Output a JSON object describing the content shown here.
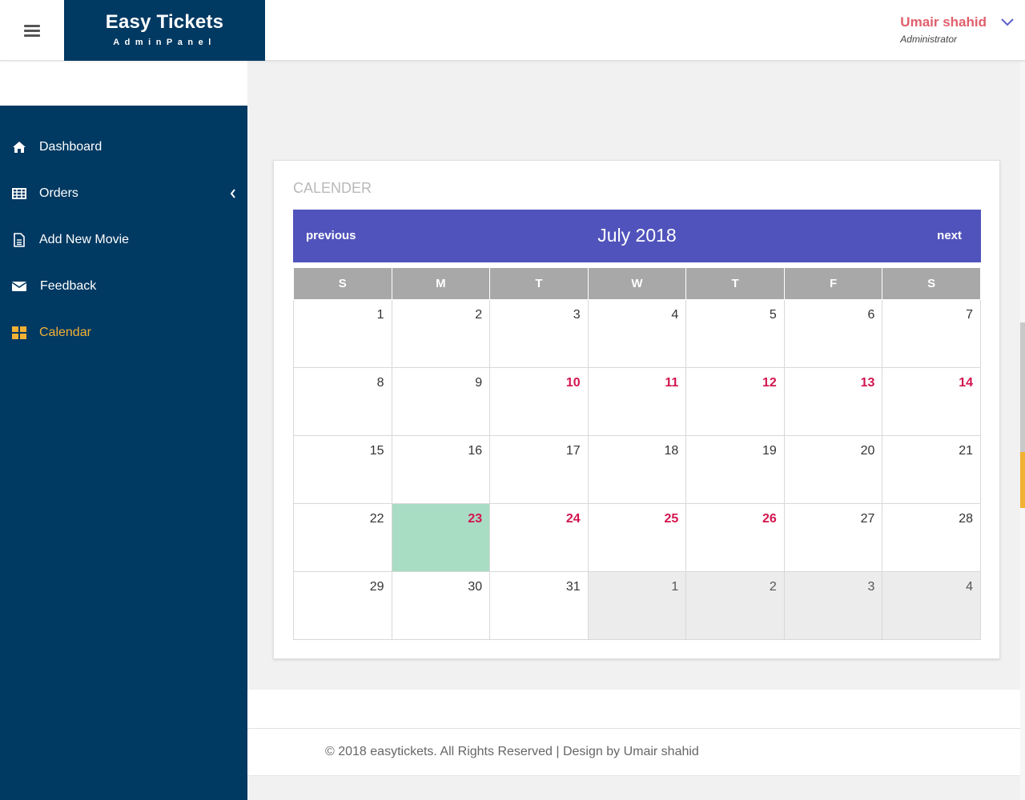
{
  "header": {
    "brand_title": "Easy Tickets",
    "brand_subtitle": "AdminPanel",
    "menu_icon": "hamburger-icon",
    "user_name": "Umair shahid",
    "user_role": "Administrator",
    "user_menu_icon": "chevron-down-icon"
  },
  "sidebar": {
    "items": [
      {
        "label": "Dashboard",
        "icon": "home-icon",
        "active": false
      },
      {
        "label": "Orders",
        "icon": "table-icon",
        "active": false,
        "has_submenu": true
      },
      {
        "label": "Add New Movie",
        "icon": "document-icon",
        "active": false
      },
      {
        "label": "Feedback",
        "icon": "envelope-icon",
        "active": false
      },
      {
        "label": "Calendar",
        "icon": "grid-icon",
        "active": true
      }
    ]
  },
  "calendar": {
    "section_title": "CALENDER",
    "previous_label": "previous",
    "next_label": "next",
    "month_label": "July 2018",
    "weekdays": [
      "S",
      "M",
      "T",
      "W",
      "T",
      "F",
      "S"
    ],
    "weeks": [
      [
        {
          "d": "1"
        },
        {
          "d": "2"
        },
        {
          "d": "3"
        },
        {
          "d": "4"
        },
        {
          "d": "5"
        },
        {
          "d": "6"
        },
        {
          "d": "7"
        }
      ],
      [
        {
          "d": "8"
        },
        {
          "d": "9"
        },
        {
          "d": "10",
          "hl": true
        },
        {
          "d": "11",
          "hl": true
        },
        {
          "d": "12",
          "hl": true
        },
        {
          "d": "13",
          "hl": true
        },
        {
          "d": "14",
          "hl": true
        }
      ],
      [
        {
          "d": "15"
        },
        {
          "d": "16"
        },
        {
          "d": "17"
        },
        {
          "d": "18"
        },
        {
          "d": "19"
        },
        {
          "d": "20"
        },
        {
          "d": "21"
        }
      ],
      [
        {
          "d": "22"
        },
        {
          "d": "23",
          "hl": true,
          "today": true
        },
        {
          "d": "24",
          "hl": true
        },
        {
          "d": "25",
          "hl": true
        },
        {
          "d": "26",
          "hl": true
        },
        {
          "d": "27"
        },
        {
          "d": "28"
        }
      ],
      [
        {
          "d": "29"
        },
        {
          "d": "30"
        },
        {
          "d": "31"
        },
        {
          "d": "1",
          "other": true
        },
        {
          "d": "2",
          "other": true
        },
        {
          "d": "3",
          "other": true
        },
        {
          "d": "4",
          "other": true
        }
      ]
    ],
    "colors": {
      "header": "#5053bb",
      "highlight": "#d3154f",
      "today": "#a8dcc3",
      "weekday_bg": "#a8a8a8"
    }
  },
  "footer": {
    "text": "© 2018 easytickets. All Rights Reserved | Design by Umair shahid"
  },
  "colors": {
    "sidebar": "#003962",
    "active": "#f2b134",
    "user_name": "#e05f6c"
  }
}
